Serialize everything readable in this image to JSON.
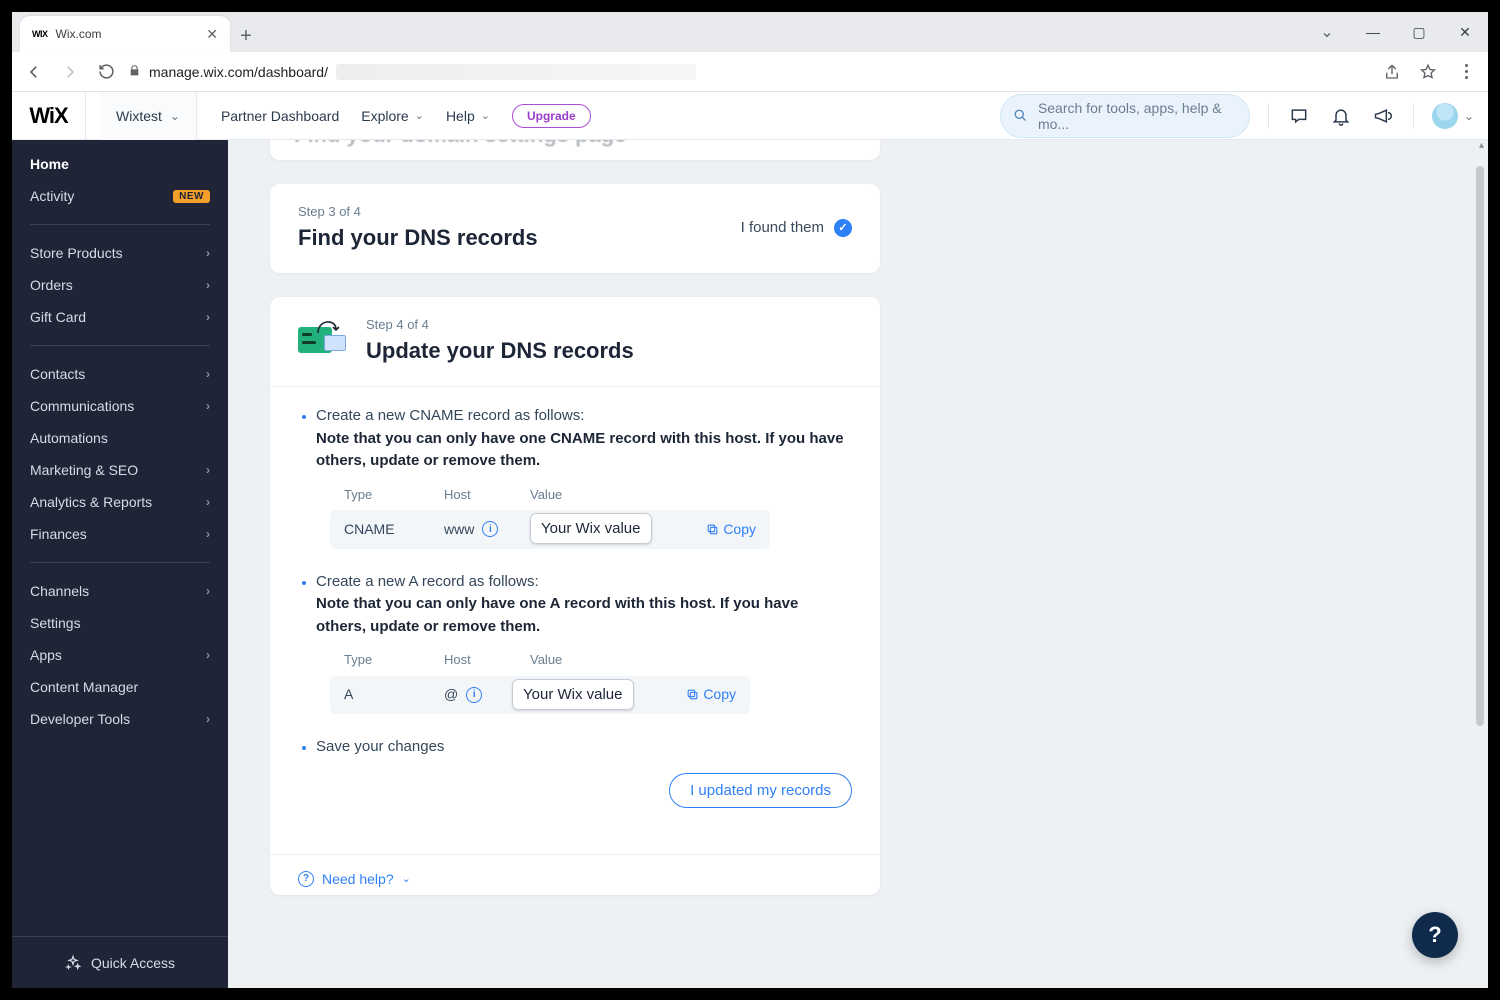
{
  "browser": {
    "tab_title": "Wix.com",
    "url_visible": "manage.wix.com/dashboard/",
    "window_buttons": {
      "chev": "⌄",
      "min": "—",
      "max": "▢",
      "close": "✕"
    }
  },
  "appbar": {
    "logo": "WiX",
    "site_name": "Wixtest",
    "nav": {
      "partner": "Partner Dashboard",
      "explore": "Explore",
      "help": "Help"
    },
    "upgrade": "Upgrade",
    "search_placeholder": "Search for tools, apps, help & mo..."
  },
  "sidebar": {
    "home": "Home",
    "activity": "Activity",
    "activity_badge": "NEW",
    "items1": [
      {
        "label": "Store Products",
        "chev": true
      },
      {
        "label": "Orders",
        "chev": true
      },
      {
        "label": "Gift Card",
        "chev": true
      }
    ],
    "items2": [
      {
        "label": "Contacts",
        "chev": true
      },
      {
        "label": "Communications",
        "chev": true
      },
      {
        "label": "Automations",
        "chev": false
      },
      {
        "label": "Marketing & SEO",
        "chev": true
      },
      {
        "label": "Analytics & Reports",
        "chev": true
      },
      {
        "label": "Finances",
        "chev": true
      }
    ],
    "items3": [
      {
        "label": "Channels",
        "chev": true
      },
      {
        "label": "Settings",
        "chev": false
      },
      {
        "label": "Apps",
        "chev": true
      },
      {
        "label": "Content Manager",
        "chev": false
      },
      {
        "label": "Developer Tools",
        "chev": true
      }
    ],
    "quick": "Quick Access"
  },
  "main": {
    "peek_title": "Find your domain settings page",
    "step3": {
      "step": "Step 3 of 4",
      "title": "Find your DNS records",
      "found": "I found them"
    },
    "step4": {
      "step": "Step 4 of 4",
      "title": "Update your DNS records",
      "cname_intro": "Create a new CNAME record as follows:",
      "cname_note": "Note that you can only have one CNAME record with this host. If you have others, update or remove them.",
      "a_intro": "Create a new A record as follows:",
      "a_note": "Note that you can only have one A record with this host. If you have others, update or remove them.",
      "save": "Save your changes",
      "table_headers": {
        "type": "Type",
        "host": "Host",
        "value": "Value"
      },
      "cname_row": {
        "type": "CNAME",
        "host": "www",
        "value": "Your Wix value",
        "copy": "Copy"
      },
      "a_row": {
        "type": "A",
        "host": "@",
        "value": "Your Wix value",
        "copy": "Copy"
      },
      "updated_btn": "I updated my records"
    },
    "need_help": "Need help?"
  },
  "helpfab": "?"
}
